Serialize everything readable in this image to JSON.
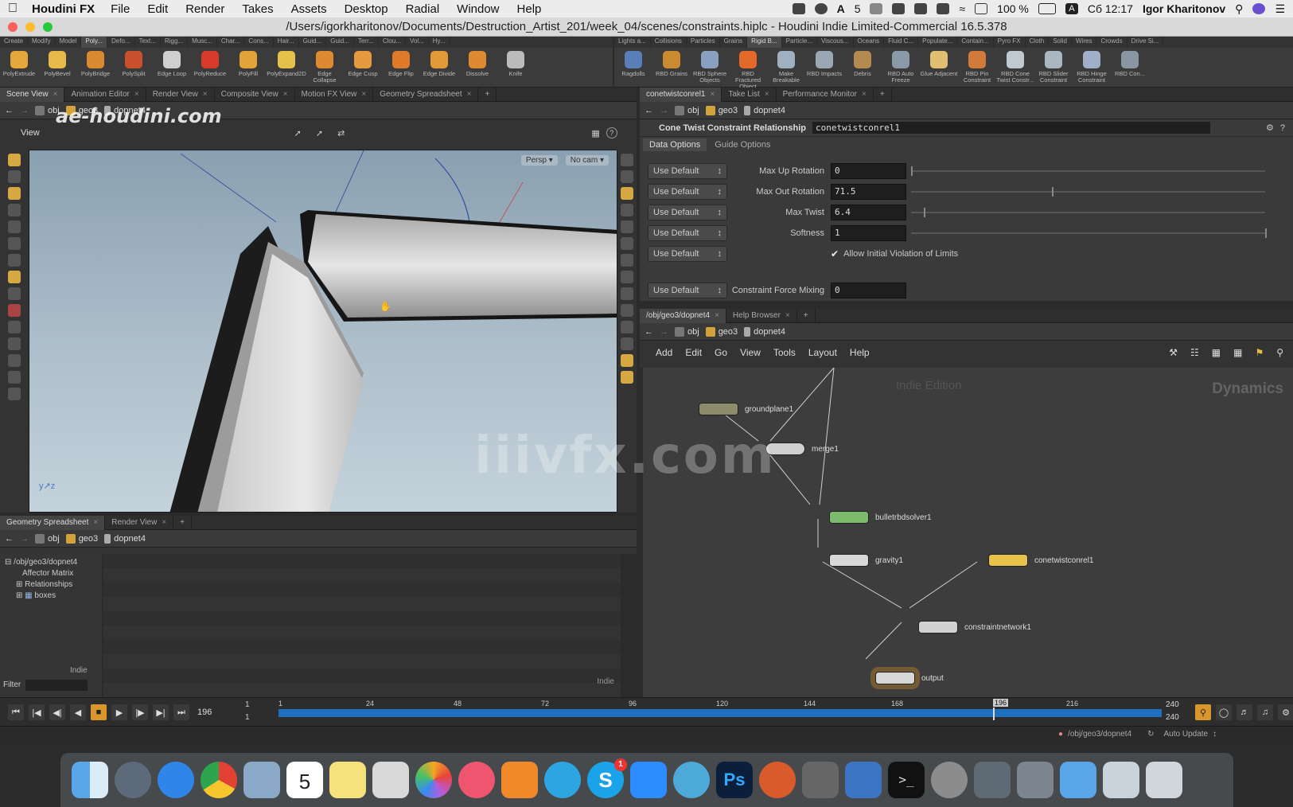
{
  "menubar": {
    "app_name": "Houdini FX",
    "items": [
      "File",
      "Edit",
      "Render",
      "Takes",
      "Assets",
      "Desktop",
      "Radial",
      "Window",
      "Help"
    ],
    "status_extras": [
      "5"
    ],
    "battery": "100 %",
    "clock": "Сб 12:17",
    "user": "Igor Kharitonov"
  },
  "window": {
    "title": "/Users/igorkharitonov/Documents/Destruction_Artist_201/week_04/scenes/constraints.hiplc - Houdini Indie Limited-Commercial 16.5.378"
  },
  "shelf_left": {
    "tabs": [
      "Create",
      "Modify",
      "Model",
      "Poly...",
      "Defo...",
      "Text...",
      "Rigg...",
      "Musc...",
      "Char...",
      "Cons...",
      "Hair...",
      "Guid...",
      "Guid...",
      "Terr...",
      "Clou...",
      "Vol...",
      "Hy..."
    ],
    "tools": [
      "PolyExtrude",
      "PolyBevel",
      "PolyBridge",
      "PolySplit",
      "Edge Loop",
      "PolyReduce",
      "PolyFill",
      "PolyExpand2D",
      "Edge Collapse",
      "Edge Cusp",
      "Edge Flip",
      "Edge Divide",
      "Dissolve",
      "Knife"
    ]
  },
  "shelf_right": {
    "tabs": [
      "Lights a...",
      "Collisions",
      "Particles",
      "Grains",
      "Rigid B...",
      "Particle...",
      "Viscous...",
      "Oceans",
      "Fluid C...",
      "Populate...",
      "Contain...",
      "Pyro FX",
      "Cloth",
      "Solid",
      "Wires",
      "Crowds",
      "Drive Si..."
    ],
    "tools": [
      "Ragdolls",
      "RBD Grains",
      "RBD Sphere Objects",
      "RBD Fractured Object",
      "Make Breakable",
      "RBD Impacts",
      "Debris",
      "RBD Auto Freeze",
      "Glue Adjacent",
      "RBD Pin Constraint",
      "RBD Cone Twist Constr...",
      "RBD Slider Constraint",
      "RBD Hinge Constraint",
      "RBD Con..."
    ]
  },
  "scene_tabs": [
    "Scene View",
    "Animation Editor",
    "Render View",
    "Composite View",
    "Motion FX View",
    "Geometry Spreadsheet"
  ],
  "path": {
    "obj": "obj",
    "geo": "geo3",
    "dopnet": "dopnet4"
  },
  "viewport": {
    "label": "View",
    "persp": "Persp ▾",
    "cam": "No cam ▾"
  },
  "params": {
    "tabs": [
      "conetwistconrel1",
      "Take List",
      "Performance Monitor"
    ],
    "type_label": "Cone Twist Constraint Relationship",
    "node_name": "conetwistconrel1",
    "subtabs": [
      "Data Options",
      "Guide Options"
    ],
    "rows": [
      {
        "label": "Max Up Rotation",
        "value": "0",
        "slider": 0
      },
      {
        "label": "Max Out Rotation",
        "value": "71.5",
        "slider": 0.397
      },
      {
        "label": "Max Twist",
        "value": "6.4",
        "slider": 0.036
      },
      {
        "label": "Softness",
        "value": "1",
        "slider": 1
      }
    ],
    "checkbox_label": "Allow Initial Violation of Limits",
    "force_label": "Constraint Force Mixing",
    "force_value": "0",
    "use_default": "Use Default"
  },
  "network": {
    "tabs": [
      "/obj/geo3/dopnet4",
      "Help Browser"
    ],
    "menu": [
      "Add",
      "Edit",
      "Go",
      "View",
      "Tools",
      "Layout",
      "Help"
    ],
    "context_label": "Dynamics",
    "edition_label": "Indie Edition",
    "nodes": [
      {
        "name": "groundplane1",
        "color": "#8c8c6a"
      },
      {
        "name": "merge1",
        "color": "#cfcfcf"
      },
      {
        "name": "bulletrbdsolver1",
        "color": "#7dbb6c"
      },
      {
        "name": "gravity1",
        "color": "#d8d8d8"
      },
      {
        "name": "conetwistconrel1",
        "color": "#e6c34a"
      },
      {
        "name": "constraintnetwork1",
        "color": "#d0d0d0"
      },
      {
        "name": "output",
        "color": "#d7d7d7"
      }
    ]
  },
  "spreadsheet": {
    "tabs": [
      "Geometry Spreadsheet",
      "Render View"
    ],
    "tree": [
      "/obj/geo3/dopnet4",
      "Affector Matrix",
      "Relationships",
      "boxes"
    ],
    "filter_label": "Filter",
    "indie_badge": "Indie"
  },
  "timeline": {
    "current_frame": "196",
    "start": "1",
    "start2": "1",
    "end": "240",
    "end2": "240",
    "ticks": [
      "1",
      "24",
      "48",
      "72",
      "96",
      "120",
      "144",
      "168",
      "196",
      "216"
    ]
  },
  "status": {
    "path": "/obj/geo3/dopnet4",
    "auto_update": "Auto Update"
  },
  "watermarks": {
    "top_left": "ae-houdini.com",
    "center": "iiivfx.com"
  },
  "dock": {
    "calendar_day": "5",
    "photoshop": "Ps",
    "skype_badge": "1"
  }
}
